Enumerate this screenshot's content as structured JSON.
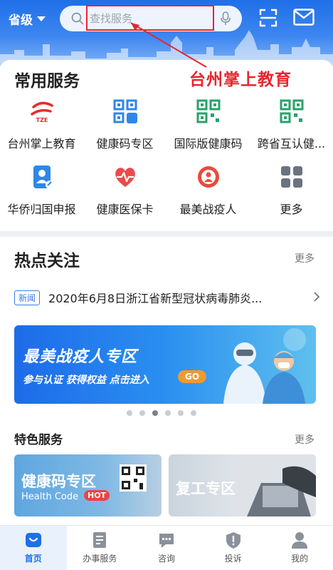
{
  "header": {
    "province": "省级",
    "search_placeholder": "查找服务"
  },
  "annotation": "台州掌上教育",
  "common": {
    "title": "常用服务",
    "items": [
      {
        "label": "台州掌上教育",
        "icon": "tze-logo-icon"
      },
      {
        "label": "健康码专区",
        "icon": "qr-code-zhe-icon"
      },
      {
        "label": "国际版健康码",
        "icon": "qr-code-green-icon"
      },
      {
        "label": "跨省互认健...",
        "icon": "qr-code-green-icon"
      },
      {
        "label": "华侨归国申报",
        "icon": "user-card-icon"
      },
      {
        "label": "健康医保卡",
        "icon": "heart-pulse-icon"
      },
      {
        "label": "最美战疫人",
        "icon": "medal-icon"
      },
      {
        "label": "更多",
        "icon": "grid-more-icon"
      }
    ],
    "tze_logo_text": "TZE"
  },
  "hot": {
    "title": "热点关注",
    "more": "更多",
    "news_badge": "新闻",
    "news_text": "2020年6月8日浙江省新型冠状病毒肺炎...",
    "banner": {
      "title": "最美战疫人专区",
      "subtitle": "参与认证 获得权益 点击进入",
      "go": "GO"
    },
    "dots_count": 6,
    "active_dot": 2
  },
  "featured": {
    "title": "特色服务",
    "more": "更多",
    "tiles": [
      {
        "main": "健康码专区",
        "sub": "Health Code",
        "badge": "HOT"
      },
      {
        "main": "复工专区"
      }
    ]
  },
  "tabs": [
    {
      "label": "首页",
      "icon": "home-icon",
      "active": true
    },
    {
      "label": "办事服务",
      "icon": "document-icon",
      "active": false
    },
    {
      "label": "咨询",
      "icon": "chat-icon",
      "active": false
    },
    {
      "label": "投诉",
      "icon": "shield-icon",
      "active": false
    },
    {
      "label": "我的",
      "icon": "profile-icon",
      "active": false
    }
  ],
  "colors": {
    "brand_blue": "#1f6fe8",
    "annotation_red": "#e8252f",
    "qr_green": "#27a36b"
  }
}
